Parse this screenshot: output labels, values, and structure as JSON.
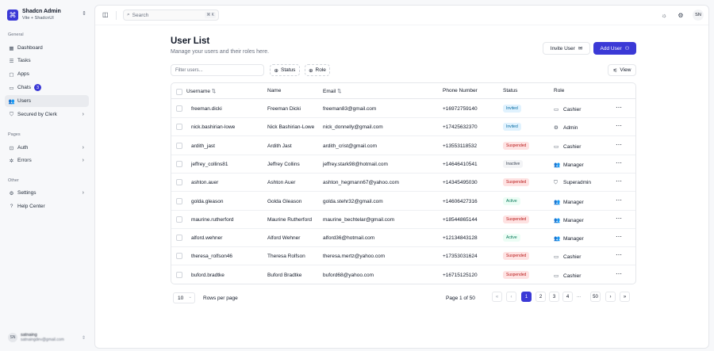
{
  "brand": {
    "title": "Shadcn Admin",
    "subtitle": "Vite + ShadcnUI",
    "logo_icon": "command-icon"
  },
  "nav": {
    "general_label": "General",
    "general": [
      {
        "label": "Dashboard",
        "icon": "layout-dashboard-icon"
      },
      {
        "label": "Tasks",
        "icon": "list-checks-icon"
      },
      {
        "label": "Apps",
        "icon": "package-icon"
      },
      {
        "label": "Chats",
        "icon": "message-square-icon",
        "badge": "3"
      },
      {
        "label": "Users",
        "icon": "users-icon",
        "active": true
      },
      {
        "label": "Secured by Clerk",
        "icon": "shield-icon"
      }
    ],
    "pages_label": "Pages",
    "pages": [
      {
        "label": "Auth",
        "icon": "lock-icon"
      },
      {
        "label": "Errors",
        "icon": "bug-icon"
      }
    ],
    "other_label": "Other",
    "other": [
      {
        "label": "Settings",
        "icon": "settings-icon"
      },
      {
        "label": "Help Center",
        "icon": "help-circle-icon"
      }
    ]
  },
  "user": {
    "initials": "SN",
    "name": "satnaing",
    "email": "satnaingdev@gmail.com"
  },
  "topbar": {
    "search_placeholder": "Search",
    "search_shortcut": "⌘ K",
    "avatar_initials": "SN"
  },
  "page": {
    "title": "User List",
    "subtitle": "Manage your users and their roles here."
  },
  "actions": {
    "invite": "Invite User",
    "add": "Add User"
  },
  "toolbar": {
    "filter_placeholder": "Filter users...",
    "status": "Status",
    "role": "Role",
    "view": "View"
  },
  "table": {
    "headers": {
      "username": "Username",
      "name": "Name",
      "email": "Email",
      "phone": "Phone Number",
      "status": "Status",
      "role": "Role"
    },
    "rows": [
      {
        "username": "freeman.dicki",
        "name": "Freeman Dicki",
        "email": "freeman83@gmail.com",
        "phone": "+16972759140",
        "status": "Invited",
        "role": "Cashier"
      },
      {
        "username": "nick.bashirian-lowe",
        "name": "Nick Bashirian-Lowe",
        "email": "nick_donnelly@gmail.com",
        "phone": "+17425632370",
        "status": "Invited",
        "role": "Admin"
      },
      {
        "username": "ardith_jast",
        "name": "Ardith Jast",
        "email": "ardith_crist@gmail.com",
        "phone": "+13553118532",
        "status": "Suspended",
        "role": "Cashier"
      },
      {
        "username": "jeffrey_collins81",
        "name": "Jeffrey Collins",
        "email": "jeffrey.stark98@hotmail.com",
        "phone": "+14646410541",
        "status": "Inactive",
        "role": "Manager"
      },
      {
        "username": "ashton.auer",
        "name": "Ashton Auer",
        "email": "ashton_hegmann67@yahoo.com",
        "phone": "+14345495030",
        "status": "Suspended",
        "role": "Superadmin"
      },
      {
        "username": "golda.gleason",
        "name": "Golda Gleason",
        "email": "golda.stehr32@gmail.com",
        "phone": "+14606427316",
        "status": "Active",
        "role": "Manager"
      },
      {
        "username": "maurine.rutherford",
        "name": "Maurine Rutherford",
        "email": "maurine_bechtelar@gmail.com",
        "phone": "+18544865144",
        "status": "Suspended",
        "role": "Manager"
      },
      {
        "username": "alford.wehner",
        "name": "Alford Wehner",
        "email": "alford36@hotmail.com",
        "phone": "+12134843128",
        "status": "Active",
        "role": "Manager"
      },
      {
        "username": "theresa_rolfson46",
        "name": "Theresa Rolfson",
        "email": "theresa.mertz@yahoo.com",
        "phone": "+17353031624",
        "status": "Suspended",
        "role": "Cashier"
      },
      {
        "username": "buford.bradtke",
        "name": "Buford Bradtke",
        "email": "buford68@yahoo.com",
        "phone": "+16715125120",
        "status": "Suspended",
        "role": "Cashier"
      }
    ]
  },
  "status_colors": {
    "Invited": {
      "bg": "#e0f2fe",
      "fg": "#0369a1"
    },
    "Suspended": {
      "bg": "#fee2e2",
      "fg": "#b91c1c"
    },
    "Inactive": {
      "bg": "#f3f4f6",
      "fg": "#374151"
    },
    "Active": {
      "bg": "#ecfdf5",
      "fg": "#047857"
    }
  },
  "role_icons": {
    "Cashier": "credit-card-icon",
    "Admin": "user-cog-icon",
    "Manager": "users-icon",
    "Superadmin": "shield-icon"
  },
  "pagination": {
    "page_size": "10",
    "rows_label": "Rows per page",
    "info": "Page 1 of 50",
    "pages": [
      "1",
      "2",
      "3",
      "4"
    ],
    "ellipsis": "...",
    "last": "50",
    "current": "1"
  },
  "accent_color": "#3b39d6"
}
